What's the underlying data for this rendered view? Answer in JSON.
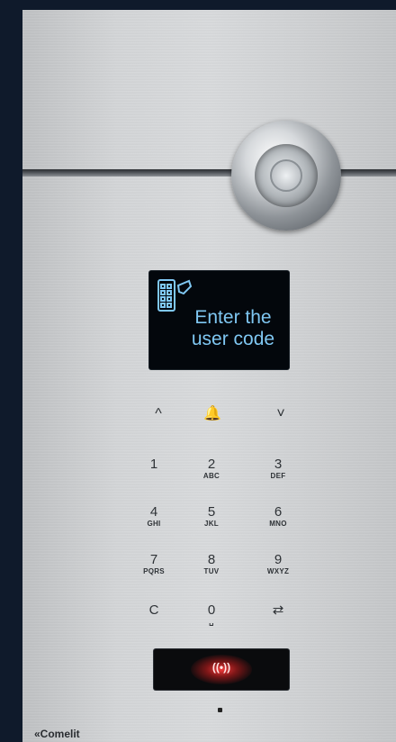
{
  "panel": {
    "screen_message": "Enter the\nuser code",
    "brand": "«Comelit"
  },
  "nav": [
    {
      "label": "^",
      "icon": "chevron-up-icon"
    },
    {
      "label": "🔔",
      "icon": "bell-icon"
    },
    {
      "label": "˅",
      "icon": "chevron-down-icon"
    }
  ],
  "keys": [
    {
      "num": "1",
      "sub": ""
    },
    {
      "num": "2",
      "sub": "ABC"
    },
    {
      "num": "3",
      "sub": "DEF"
    },
    {
      "num": "4",
      "sub": "GHI"
    },
    {
      "num": "5",
      "sub": "JKL"
    },
    {
      "num": "6",
      "sub": "MNO"
    },
    {
      "num": "7",
      "sub": "PQRS"
    },
    {
      "num": "8",
      "sub": "TUV"
    },
    {
      "num": "9",
      "sub": "WXYZ"
    },
    {
      "num": "C",
      "sub": ""
    },
    {
      "num": "0",
      "sub": "␣"
    },
    {
      "num": "⇄",
      "sub": ""
    }
  ],
  "reader": {
    "label": "((•))"
  },
  "colors": {
    "screen_text": "#7fc7f2",
    "reader_glow": "#ff3c3c",
    "frame": "#0f1a2b"
  }
}
